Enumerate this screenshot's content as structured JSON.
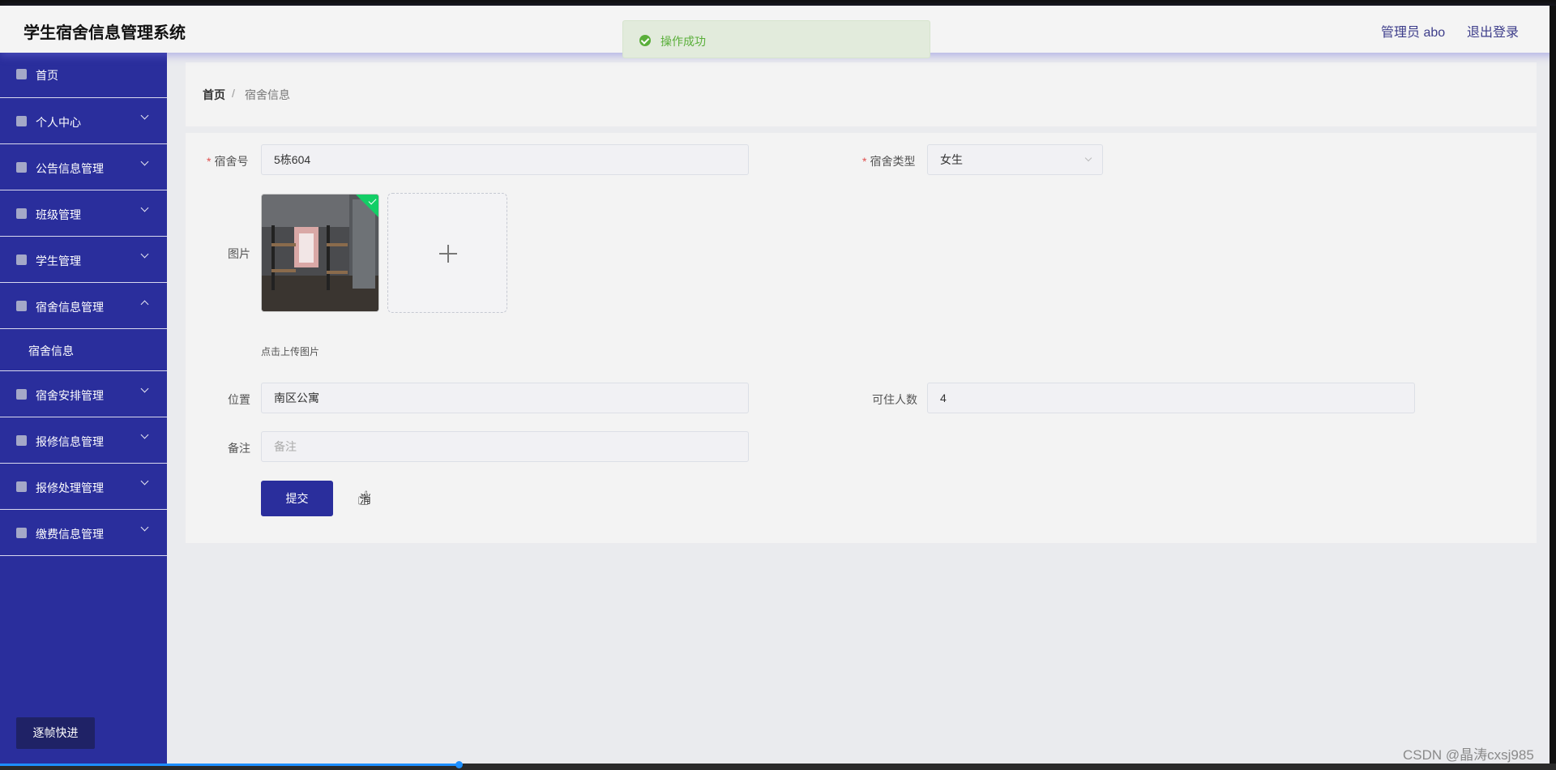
{
  "header": {
    "title": "学生宿舍信息管理系统",
    "admin": "管理员 abo",
    "logout": "退出登录"
  },
  "toast": {
    "message": "操作成功",
    "icon": "check-circle-icon",
    "color": "#5aaf3a"
  },
  "sidebar": {
    "items": [
      {
        "label": "首页",
        "icon": "home-icon"
      },
      {
        "label": "个人中心",
        "icon": "user-icon"
      },
      {
        "label": "公告信息管理",
        "icon": "clipboard-icon"
      },
      {
        "label": "班级管理",
        "icon": "id-card-icon"
      },
      {
        "label": "学生管理",
        "icon": "grid-icon"
      },
      {
        "label": "宿舍信息管理",
        "icon": "send-icon",
        "expanded": true
      },
      {
        "label": "宿舍安排管理",
        "icon": "clipboard-icon"
      },
      {
        "label": "报修信息管理",
        "icon": "sliders-icon"
      },
      {
        "label": "报修处理管理",
        "icon": "copy-icon"
      },
      {
        "label": "缴费信息管理",
        "icon": "bar-chart-icon"
      }
    ],
    "submenu": {
      "label": "宿舍信息"
    },
    "speed_button": "逐帧快进",
    "bg_color": "#2a2e9c"
  },
  "breadcrumb": {
    "home": "首页",
    "separator": "/",
    "current": "宿舍信息"
  },
  "form": {
    "dorm_no": {
      "label": "宿舍号",
      "value": "5栋604",
      "required": true
    },
    "dorm_type": {
      "label": "宿舍类型",
      "value": "女生",
      "required": true
    },
    "image": {
      "label": "图片",
      "tip": "点击上传图片"
    },
    "location": {
      "label": "位置",
      "value": "南区公寓"
    },
    "capacity": {
      "label": "可住人数",
      "value": "4"
    },
    "remark": {
      "label": "备注",
      "placeholder": "备注"
    },
    "submit": "提交",
    "cancel": "消"
  },
  "video": {
    "progress": 0.295,
    "watermark": "CSDN @晶涛cxsj985"
  }
}
